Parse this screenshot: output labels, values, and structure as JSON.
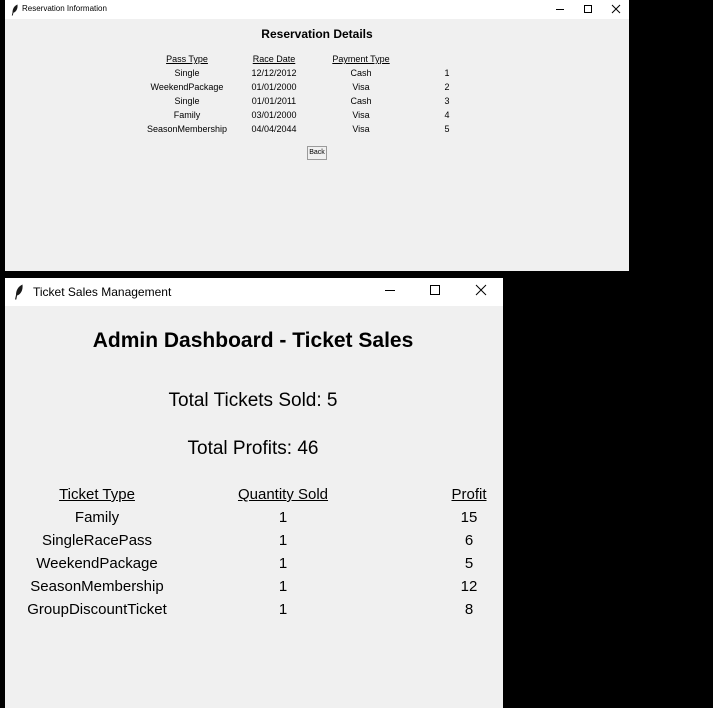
{
  "reservation_window": {
    "title": "Reservation Information",
    "heading": "Reservation Details",
    "columns": [
      "Pass Type",
      "Race Date",
      "Payment Type"
    ],
    "rows": [
      {
        "pass_type": "Single",
        "race_date": "12/12/2012",
        "payment_type": "Cash",
        "id": "1"
      },
      {
        "pass_type": "WeekendPackage",
        "race_date": "01/01/2000",
        "payment_type": "Visa",
        "id": "2"
      },
      {
        "pass_type": "Single",
        "race_date": "01/01/2011",
        "payment_type": "Cash",
        "id": "3"
      },
      {
        "pass_type": "Family",
        "race_date": "03/01/2000",
        "payment_type": "Visa",
        "id": "4"
      },
      {
        "pass_type": "SeasonMembership",
        "race_date": "04/04/2044",
        "payment_type": "Visa",
        "id": "5"
      }
    ],
    "back_label": "Back"
  },
  "sales_window": {
    "title": "Ticket Sales Management",
    "heading": "Admin Dashboard - Ticket Sales",
    "total_tickets": "Total Tickets Sold: 5",
    "total_profits": "Total Profits: 46",
    "columns": [
      "Ticket Type",
      "Quantity Sold",
      "Profit"
    ],
    "rows": [
      {
        "type": "Family",
        "quantity": "1",
        "profit": "15"
      },
      {
        "type": "SingleRacePass",
        "quantity": "1",
        "profit": "6"
      },
      {
        "type": "WeekendPackage",
        "quantity": "1",
        "profit": "5"
      },
      {
        "type": "SeasonMembership",
        "quantity": "1",
        "profit": "12"
      },
      {
        "type": "GroupDiscountTicket",
        "quantity": "1",
        "profit": "8"
      }
    ]
  },
  "icons": {
    "app": "feather-icon",
    "minimize": "minimize-icon",
    "maximize": "maximize-icon",
    "close": "close-icon"
  }
}
